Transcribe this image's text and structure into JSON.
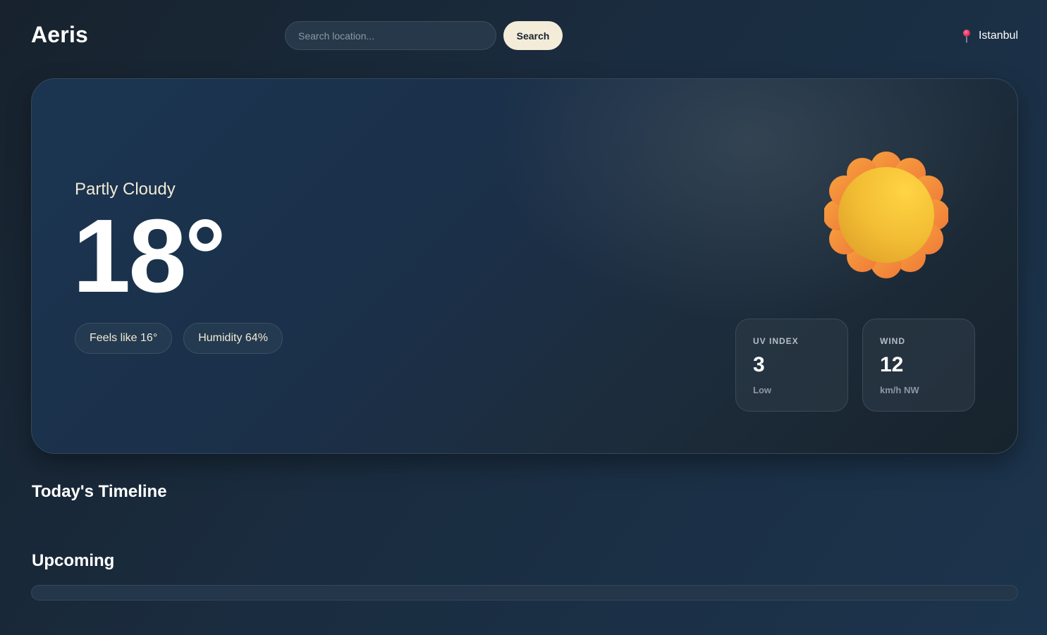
{
  "header": {
    "logo": "Aeris",
    "search_placeholder": "Search location...",
    "search_value": "",
    "search_button": "Search",
    "location": "Istanbul",
    "location_icon": "map-pin-icon"
  },
  "current": {
    "condition": "Partly Cloudy",
    "temperature": "18°",
    "feels_like": "Feels like 16°",
    "humidity": "Humidity 64%",
    "weather_icon": "sun-icon",
    "stats": {
      "uv": {
        "label": "UV INDEX",
        "value": "3",
        "sub": "Low"
      },
      "wind": {
        "label": "WIND",
        "value": "12",
        "sub": "km/h NW"
      }
    }
  },
  "sections": {
    "timeline_title": "Today's Timeline",
    "upcoming_title": "Upcoming"
  },
  "colors": {
    "accent_button": "#f3ecd8",
    "pin": "#e8335b",
    "sun_core": "#f6c23a",
    "sun_petals": "#f4893a",
    "background_dark": "#17222d",
    "background_light": "#1c344d"
  }
}
